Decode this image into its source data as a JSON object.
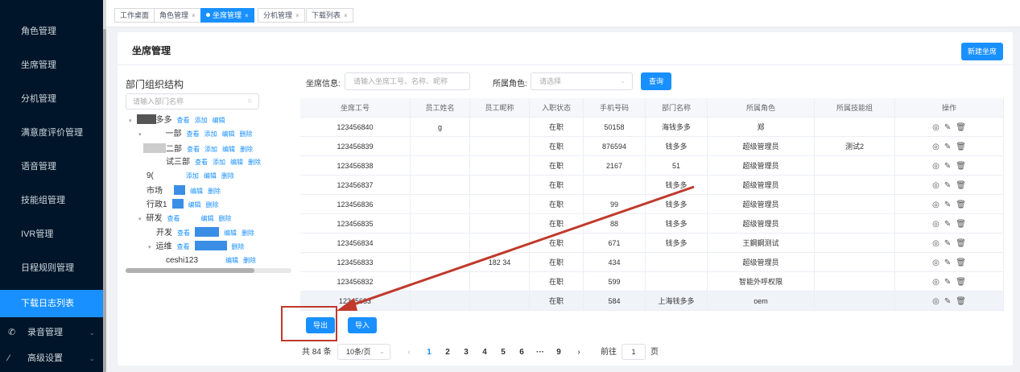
{
  "sidebar": {
    "items": [
      {
        "label": "角色管理"
      },
      {
        "label": "坐席管理"
      },
      {
        "label": "分机管理"
      },
      {
        "label": "满意度评价管理"
      },
      {
        "label": "语音管理"
      },
      {
        "label": "技能组管理"
      },
      {
        "label": "IVR管理"
      },
      {
        "label": "日程规则管理"
      },
      {
        "label": "下载日志列表"
      },
      {
        "label": "录音管理"
      },
      {
        "label": "高级设置"
      }
    ]
  },
  "tabs": [
    {
      "label": "工作桌面"
    },
    {
      "label": "角色管理"
    },
    {
      "label": "坐席管理"
    },
    {
      "label": "分机管理"
    },
    {
      "label": "下载列表"
    }
  ],
  "panel": {
    "title": "坐席管理",
    "new_button": "新建坐席"
  },
  "tree": {
    "title": "部门组织结构",
    "search_placeholder": "请输入部门名称",
    "action_view": "查看",
    "action_add": "添加",
    "action_edit": "编辑",
    "action_delete": "删除",
    "nodes": [
      "多多",
      "一部",
      "二部",
      "试三部",
      "9(",
      "市场",
      "行政1",
      "研发",
      "开发",
      "运维",
      "ceshi123"
    ]
  },
  "filter": {
    "agent_label": "坐席信息:",
    "agent_placeholder": "请输入坐席工号、名称、昵称",
    "role_label": "所属角色:",
    "role_placeholder": "请选择",
    "query_button": "查询"
  },
  "table": {
    "headers": [
      "坐席工号",
      "员工姓名",
      "员工昵称",
      "入职状态",
      "手机号码",
      "部门名称",
      "所属角色",
      "所属技能组",
      "操作"
    ],
    "rows": [
      [
        "123456840",
        "g",
        "",
        "在职",
        "50158",
        "海钱多多",
        "郑",
        ""
      ],
      [
        "123456839",
        "",
        "",
        "在职",
        "876594",
        "钱多多",
        "超级管理员",
        "测试2"
      ],
      [
        "123456838",
        "",
        "",
        "在职",
        "2167",
        "51",
        "超级管理员",
        ""
      ],
      [
        "123456837",
        "",
        "",
        "在职",
        "",
        "钱多多",
        "超级管理员",
        ""
      ],
      [
        "123456836",
        "",
        "",
        "在职",
        "99",
        "钱多多",
        "超级管理员",
        ""
      ],
      [
        "123456835",
        "",
        "",
        "在职",
        "88",
        "钱多多",
        "超级管理员",
        ""
      ],
      [
        "123456834",
        "",
        "",
        "在职",
        "671",
        "钱多多",
        "王鋼鋼测试",
        ""
      ],
      [
        "123456833",
        "",
        "182 34",
        "在职",
        "434",
        "",
        "超级管理员",
        ""
      ],
      [
        "123456832",
        "",
        "",
        "在职",
        "599",
        "",
        "智能外呼权限",
        ""
      ],
      [
        "12345683",
        "",
        "",
        "在职",
        "584",
        "上海钱多多",
        "oem",
        ""
      ]
    ],
    "op_icons": [
      "eye-icon",
      "edit-icon",
      "trash-icon"
    ]
  },
  "actions": {
    "export_button": "导出",
    "import_button": "导入"
  },
  "pagination": {
    "total_text": "共 84 条",
    "page_size": "10条/页",
    "pages": [
      "1",
      "2",
      "3",
      "4",
      "5",
      "6",
      "···",
      "9"
    ],
    "current_page": "1",
    "goto_prefix": "前往",
    "goto_value": "1",
    "goto_suffix": "页"
  },
  "colors": {
    "accent": "#1890ff",
    "sidebar_bg": "#001529",
    "annotation_red": "#c0392b"
  }
}
